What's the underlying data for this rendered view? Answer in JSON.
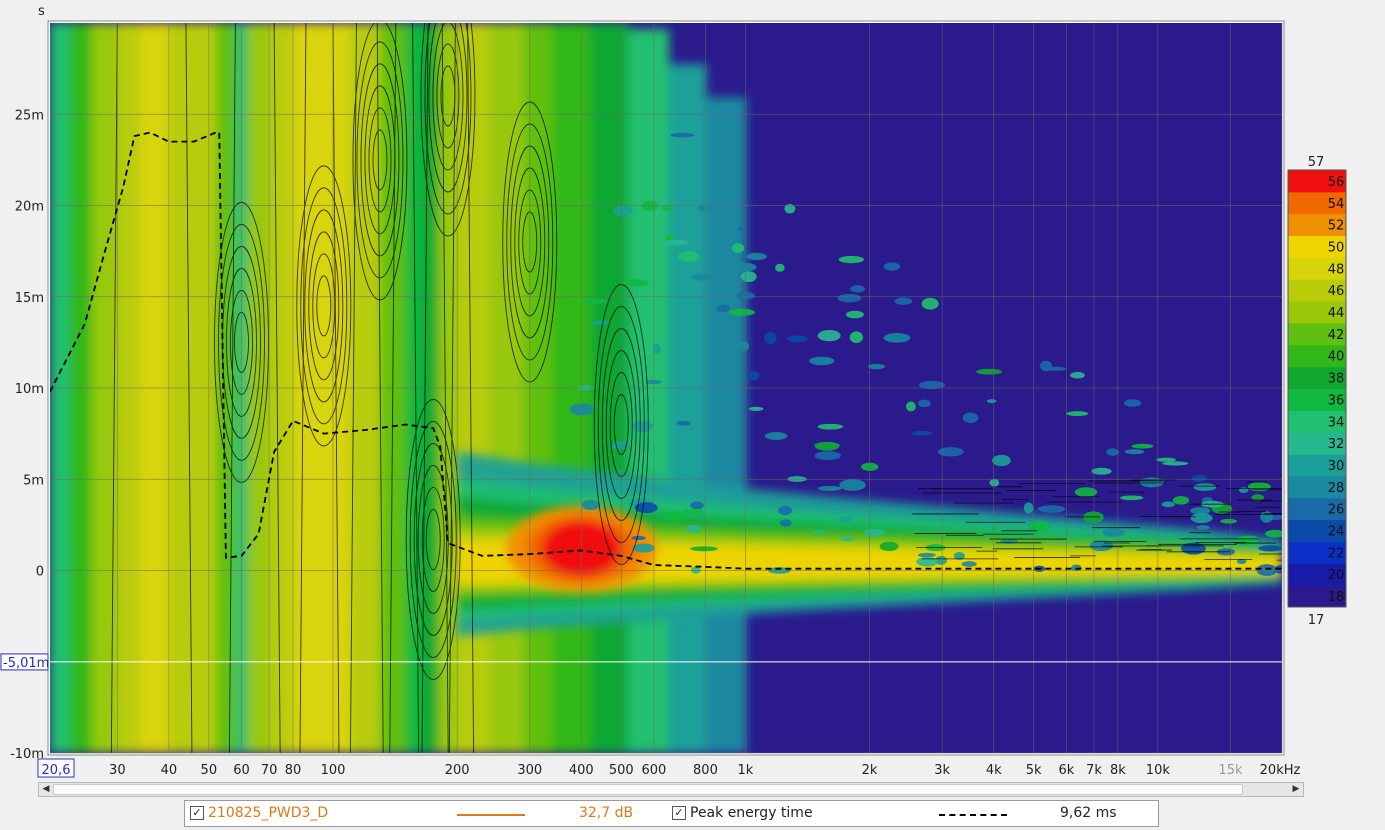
{
  "chart_data": {
    "type": "heatmap",
    "title": "",
    "xlabel": "",
    "ylabel": "s",
    "x_scale": "log",
    "xlim": [
      20.6,
      20000
    ],
    "ylim": [
      -0.01,
      0.03
    ],
    "x_ticks": [
      {
        "value": 30,
        "label": "30"
      },
      {
        "value": 40,
        "label": "40"
      },
      {
        "value": 50,
        "label": "50"
      },
      {
        "value": 60,
        "label": "60"
      },
      {
        "value": 70,
        "label": "70"
      },
      {
        "value": 80,
        "label": "80"
      },
      {
        "value": 100,
        "label": "100"
      },
      {
        "value": 200,
        "label": "200"
      },
      {
        "value": 300,
        "label": "300"
      },
      {
        "value": 400,
        "label": "400"
      },
      {
        "value": 500,
        "label": "500"
      },
      {
        "value": 600,
        "label": "600"
      },
      {
        "value": 800,
        "label": "800"
      },
      {
        "value": 1000,
        "label": "1k"
      },
      {
        "value": 2000,
        "label": "2k"
      },
      {
        "value": 3000,
        "label": "3k"
      },
      {
        "value": 4000,
        "label": "4k"
      },
      {
        "value": 5000,
        "label": "5k"
      },
      {
        "value": 6000,
        "label": "6k"
      },
      {
        "value": 7000,
        "label": "7k"
      },
      {
        "value": 8000,
        "label": "8k"
      },
      {
        "value": 10000,
        "label": "10k"
      },
      {
        "value": 15000,
        "label": "15k",
        "muted": true
      },
      {
        "value": 20000,
        "label": "20kHz"
      }
    ],
    "x_start_label": "20,6",
    "y_ticks": [
      {
        "value": -0.01,
        "label": "-10m"
      },
      {
        "value": 0,
        "label": "0"
      },
      {
        "value": 0.005,
        "label": "5m"
      },
      {
        "value": 0.01,
        "label": "10m"
      },
      {
        "value": 0.015,
        "label": "15m"
      },
      {
        "value": 0.02,
        "label": "20m"
      },
      {
        "value": 0.025,
        "label": "25m"
      }
    ],
    "cursor": {
      "value": -0.00501,
      "label": "-5,01m"
    },
    "colorbar": {
      "min": 17,
      "max": 57,
      "min_label": "17",
      "max_label": "57",
      "tick_labels": [
        "56",
        "54",
        "52",
        "50",
        "48",
        "46",
        "44",
        "42",
        "40",
        "38",
        "36",
        "34",
        "32",
        "30",
        "28",
        "26",
        "24",
        "22",
        "20",
        "18"
      ],
      "bands": [
        {
          "from": 17,
          "to": 19,
          "color": "#2a1a8c"
        },
        {
          "from": 19,
          "to": 21,
          "color": "#1a1aa8"
        },
        {
          "from": 21,
          "to": 23,
          "color": "#0a30c8"
        },
        {
          "from": 23,
          "to": 25,
          "color": "#0a4aa8"
        },
        {
          "from": 25,
          "to": 27,
          "color": "#1a6aa8"
        },
        {
          "from": 27,
          "to": 29,
          "color": "#1a88a0"
        },
        {
          "from": 29,
          "to": 31,
          "color": "#1aa098"
        },
        {
          "from": 31,
          "to": 33,
          "color": "#28b890"
        },
        {
          "from": 33,
          "to": 35,
          "color": "#20c070"
        },
        {
          "from": 35,
          "to": 37,
          "color": "#10b840"
        },
        {
          "from": 37,
          "to": 39,
          "color": "#10a830"
        },
        {
          "from": 39,
          "to": 41,
          "color": "#30b818"
        },
        {
          "from": 41,
          "to": 43,
          "color": "#60c010"
        },
        {
          "from": 43,
          "to": 45,
          "color": "#98c808"
        },
        {
          "from": 45,
          "to": 47,
          "color": "#b8cc08"
        },
        {
          "from": 47,
          "to": 49,
          "color": "#d8d408"
        },
        {
          "from": 49,
          "to": 51,
          "color": "#f0d400"
        },
        {
          "from": 51,
          "to": 53,
          "color": "#f09000"
        },
        {
          "from": 53,
          "to": 55,
          "color": "#f06800"
        },
        {
          "from": 55,
          "to": 57,
          "color": "#f01010"
        }
      ]
    },
    "series": [
      {
        "name": "Peak energy time",
        "style": "dashed",
        "color": "#000000",
        "x": [
          20.6,
          25,
          28,
          31,
          33,
          36,
          40,
          46,
          52,
          53,
          55,
          60,
          66,
          72,
          80,
          95,
          120,
          150,
          175,
          182,
          190,
          230,
          300,
          400,
          500,
          600,
          800,
          1000,
          1500,
          2000,
          3000,
          5000,
          10000,
          20000
        ],
        "y": [
          0.0098,
          0.0135,
          0.0175,
          0.021,
          0.0238,
          0.024,
          0.0235,
          0.0235,
          0.024,
          0.024,
          0.0007,
          0.0008,
          0.002,
          0.0065,
          0.0082,
          0.0075,
          0.0077,
          0.008,
          0.0078,
          0.0068,
          0.0015,
          0.0008,
          0.0009,
          0.0011,
          0.0008,
          0.0003,
          0.0002,
          0.0001,
          0.0001,
          0.0001,
          0.0001,
          0.0001,
          0.0001,
          0.0001
        ]
      }
    ],
    "legend_position": "bottom"
  },
  "legend": {
    "measurement_name": "210825_PWD3_D",
    "measurement_value": "32,7 dB",
    "measurement_color": "#e07818",
    "peak_name": "Peak energy time",
    "peak_value": "9,62 ms",
    "check_glyph": "✓"
  },
  "scroll": {
    "left_arrow": "◀",
    "right_arrow": "▶"
  }
}
